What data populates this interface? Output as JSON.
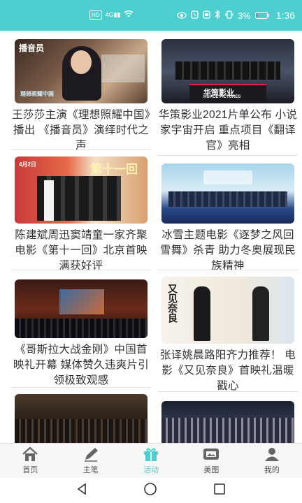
{
  "status_bar": {
    "hd_badge": "HD",
    "signal": "4G",
    "battery": "3%",
    "time": "1:36"
  },
  "feed": {
    "cards": [
      {
        "title": "王莎莎主演《理想照耀中国》播出 《播音员》演绎时代之声",
        "image_caption": "播音员",
        "image_subtitle": "理想照耀中国"
      },
      {
        "title": "华策影业2021片单公布 小说家宇宙开启 重点项目《翻译官》亮相",
        "image_caption": "华策影业",
        "image_subtitle": "HUACE PICTURES"
      },
      {
        "title": "陈建斌周迅窦靖童一家齐聚 电影《第十一回》北京首映满获好评",
        "image_caption": "第十一回",
        "image_subtitle": "4月2日"
      },
      {
        "title": "冰雪主题电影《逐梦之风回雪舞》杀青 助力冬奥展现民族精神",
        "image_caption": "",
        "image_subtitle": ""
      },
      {
        "title": "《哥斯拉大战金刚》中国首映礼开幕 媒体赞久违爽片引领极致观感",
        "image_caption": "",
        "image_subtitle": ""
      },
      {
        "title": "张译姚晨路阳齐力推荐！ 电影《又见奈良》首映礼温暖戳心",
        "image_caption": "又见奈良",
        "image_subtitle": ""
      },
      {
        "title": "",
        "image_caption": "",
        "image_subtitle": ""
      },
      {
        "title": "",
        "image_caption": "",
        "image_subtitle": ""
      }
    ]
  },
  "bottom_nav": {
    "items": [
      {
        "label": "首页",
        "icon": "home-icon"
      },
      {
        "label": "主笔",
        "icon": "pen-icon"
      },
      {
        "label": "活动",
        "icon": "gift-icon",
        "active": true
      },
      {
        "label": "美图",
        "icon": "picture-icon"
      },
      {
        "label": "我的",
        "icon": "user-icon"
      }
    ]
  },
  "colors": {
    "accent": "#4ecfcf",
    "text": "#333333"
  }
}
